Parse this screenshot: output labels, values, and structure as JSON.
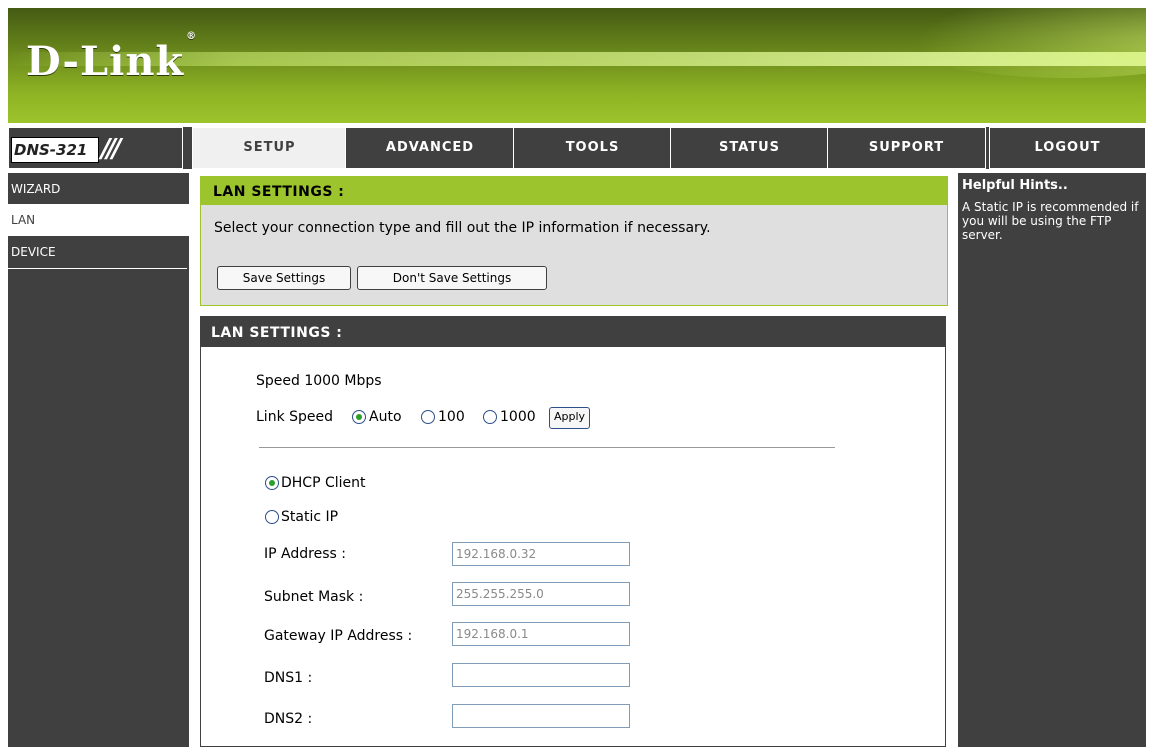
{
  "brand": {
    "logo": "D-Link",
    "reg": "®",
    "model": "DNS-321"
  },
  "nav": {
    "tabs": [
      {
        "label": "SETUP",
        "active": true
      },
      {
        "label": "ADVANCED",
        "active": false
      },
      {
        "label": "TOOLS",
        "active": false
      },
      {
        "label": "STATUS",
        "active": false
      },
      {
        "label": "SUPPORT",
        "active": false
      },
      {
        "label": "LOGOUT",
        "active": false
      }
    ]
  },
  "sidebar": {
    "items": [
      {
        "label": "WIZARD",
        "active": false
      },
      {
        "label": "LAN",
        "active": true
      },
      {
        "label": "DEVICE",
        "active": false
      }
    ]
  },
  "intro": {
    "title": "LAN SETTINGS :",
    "description": "Select your connection type and fill out the IP information if necessary.",
    "save_label": "Save Settings",
    "dont_save_label": "Don't Save Settings"
  },
  "lan": {
    "title": "LAN SETTINGS :",
    "speed_text": "Speed 1000 Mbps",
    "link_speed_label": "Link Speed",
    "speed_options": [
      {
        "label": "Auto",
        "selected": true
      },
      {
        "label": "100",
        "selected": false
      },
      {
        "label": "1000",
        "selected": false
      }
    ],
    "apply_label": "Apply",
    "mode_options": [
      {
        "label": "DHCP Client",
        "selected": true
      },
      {
        "label": "Static IP",
        "selected": false
      }
    ],
    "fields": [
      {
        "label": "IP Address :",
        "value": "192.168.0.32"
      },
      {
        "label": "Subnet Mask :",
        "value": "255.255.255.0"
      },
      {
        "label": "Gateway IP Address :",
        "value": "192.168.0.1"
      },
      {
        "label": "DNS1 :",
        "value": ""
      },
      {
        "label": "DNS2 :",
        "value": ""
      }
    ]
  },
  "hints": {
    "title": "Helpful Hints..",
    "text": "A Static IP is recommended if you will be using the FTP server."
  },
  "colors": {
    "accent": "#9cc42c",
    "dark": "#404040",
    "panel": "#dfdfdf"
  }
}
